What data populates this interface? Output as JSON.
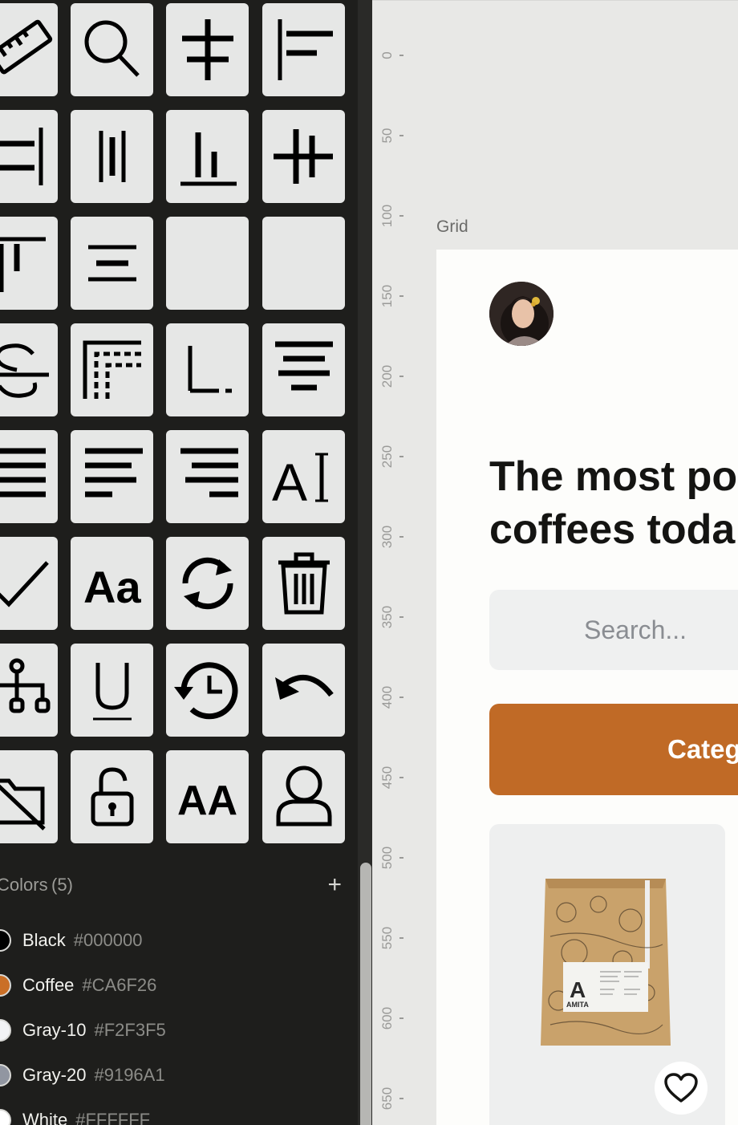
{
  "icon_grid": {
    "tiles": [
      "ruler-icon",
      "search-icon",
      "align-vertical-center-icon",
      "align-left-icon",
      "align-right-icon",
      "distribute-horizontal-icon",
      "align-bottom-icon",
      "align-horizontal-center-icon",
      "align-top-icon",
      "align-center-text-icon",
      "empty-tile",
      "empty-tile",
      "strikethrough-icon",
      "padding-icon",
      "baseline-icon",
      "text-align-center-icon",
      "text-justify-icon",
      "text-align-left-icon",
      "text-align-right-icon",
      "text-cursor-icon",
      "check-icon",
      "font-size-icon",
      "refresh-icon",
      "trash-icon",
      "hierarchy-icon",
      "underline-icon",
      "history-icon",
      "undo-icon",
      "folder-off-icon",
      "unlock-icon",
      "uppercase-icon",
      "user-icon"
    ],
    "cursor_glyph": "AI",
    "font_glyph": "Aa",
    "uppercase_glyph": "AA"
  },
  "colors_panel": {
    "title": "Colors",
    "count": "(5)",
    "add_label": "+",
    "items": [
      {
        "name": "Black",
        "hex": "#000000",
        "swatch": "#000000"
      },
      {
        "name": "Coffee",
        "hex": "#CA6F26",
        "swatch": "#CA6F26"
      },
      {
        "name": "Gray-10",
        "hex": "#F2F3F5",
        "swatch": "#F2F3F5"
      },
      {
        "name": "Gray-20",
        "hex": "#9196A1",
        "swatch": "#9196A1"
      },
      {
        "name": "White",
        "hex": "#FFFFFF",
        "swatch": "#FFFFFF"
      }
    ]
  },
  "ruler": {
    "ticks": [
      "0",
      "50",
      "100",
      "150",
      "200",
      "250",
      "300",
      "350",
      "400",
      "450",
      "500",
      "550",
      "600",
      "650"
    ]
  },
  "canvas": {
    "frame_label": "Grid",
    "headline_line1": "The most po",
    "headline_line2": "coffees toda",
    "search_placeholder": "Search...",
    "category_label": "Categ",
    "product_brand": "AMITA"
  },
  "colors": {
    "panel_bg": "#1e1e1c",
    "tile_bg": "#e6e7e6",
    "canvas_bg": "#e8e8e6",
    "accent": "#c06a26"
  }
}
